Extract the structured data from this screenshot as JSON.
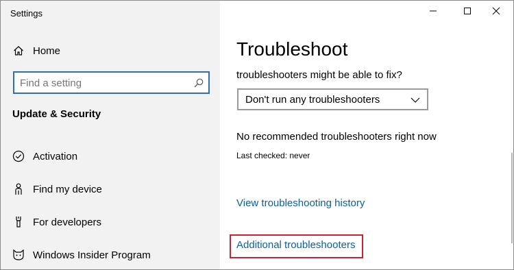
{
  "window": {
    "title": "Settings"
  },
  "sidebar": {
    "home_label": "Home",
    "search": {
      "placeholder": "Find a setting"
    },
    "section_title": "Update & Security",
    "items": [
      {
        "label": "Activation",
        "icon": "check-circle-icon"
      },
      {
        "label": "Find my device",
        "icon": "person-pin-icon"
      },
      {
        "label": "For developers",
        "icon": "developer-tools-icon"
      },
      {
        "label": "Windows Insider Program",
        "icon": "insider-cat-icon"
      }
    ]
  },
  "main": {
    "title": "Troubleshoot",
    "question_text": "troubleshooters might be able to fix?",
    "dropdown": {
      "selected": "Don't run any troubleshooters"
    },
    "status_text": "No recommended troubleshooters right now",
    "last_checked": "Last checked: never",
    "history_link": "View troubleshooting history",
    "additional_link": "Additional troubleshooters"
  },
  "colors": {
    "accent": "#2b6fb6",
    "link": "#0a5fa0",
    "highlight": "#d02030",
    "sidebar_bg": "#f2f2f2"
  }
}
